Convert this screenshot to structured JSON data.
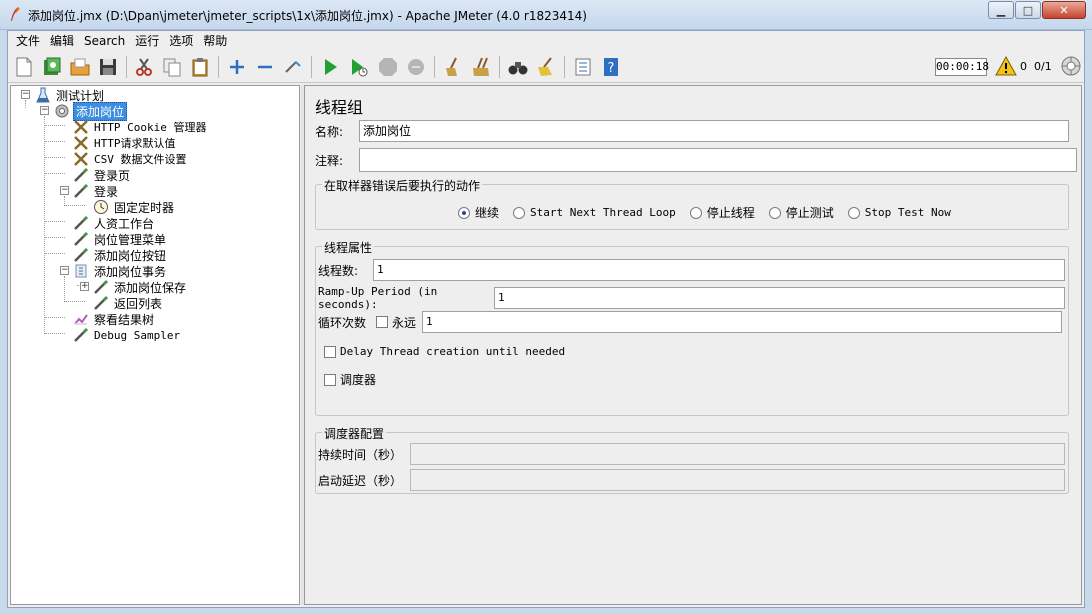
{
  "window": {
    "title": "添加岗位.jmx (D:\\Dpan\\jmeter\\jmeter_scripts\\1x\\添加岗位.jmx) - Apache JMeter (4.0 r1823414)",
    "minimize": "▁",
    "maximize": "□",
    "close": "✕"
  },
  "menu": [
    "文件",
    "编辑",
    "Search",
    "运行",
    "选项",
    "帮助"
  ],
  "status": {
    "timer": "00:00:18",
    "warnings": "0",
    "threads": "0/1"
  },
  "tree": {
    "root": "测试计划",
    "thread_group": "添加岗位",
    "items": [
      "HTTP Cookie 管理器",
      "HTTP请求默认值",
      "CSV 数据文件设置",
      "登录页",
      "登录",
      "固定定时器",
      "人资工作台",
      "岗位管理菜单",
      "添加岗位按钮",
      "添加岗位事务",
      "添加岗位保存",
      "返回列表",
      "察看结果树",
      "Debug Sampler"
    ]
  },
  "panel": {
    "title": "线程组",
    "name_label": "名称:",
    "name_value": "添加岗位",
    "comment_label": "注释:",
    "comment_value": "",
    "error_group_title": "在取样器错误后要执行的动作",
    "error_actions": [
      "继续",
      "Start Next Thread Loop",
      "停止线程",
      "停止测试",
      "Stop Test Now"
    ],
    "thread_props_title": "线程属性",
    "threads_label": "线程数:",
    "threads_value": "1",
    "rampup_label": "Ramp-Up Period (in seconds):",
    "rampup_value": "1",
    "loop_label": "循环次数",
    "forever_label": "永远",
    "loop_value": "1",
    "delay_label": "Delay Thread creation until needed",
    "scheduler_label": "调度器",
    "scheduler_group_title": "调度器配置",
    "duration_label": "持续时间（秒）",
    "startup_delay_label": "启动延迟（秒）"
  }
}
